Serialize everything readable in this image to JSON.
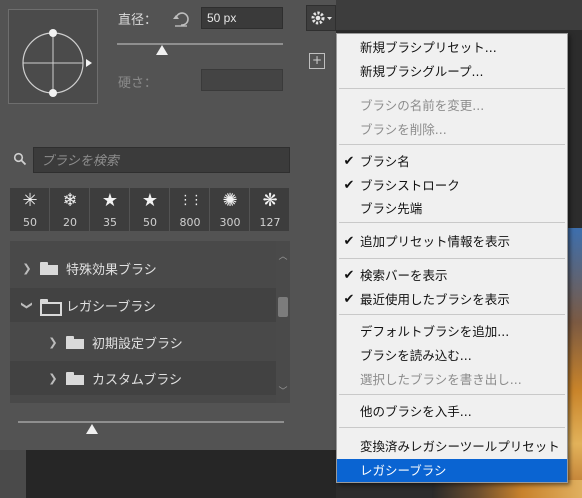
{
  "panel": {
    "diameter_label": "直径：",
    "size_value": "50 px",
    "hardness_label": "硬さ：",
    "search_placeholder": "ブラシを検索",
    "add_brush_symbol": "+",
    "brush_size_fraction": 0.27,
    "bottom_size_fraction": 0.28,
    "recent_brushes": [
      {
        "icon": "spark-brush-icon",
        "glyph": "✳",
        "size": "50"
      },
      {
        "icon": "snowflake-brush-icon",
        "glyph": "❄",
        "size": "20"
      },
      {
        "icon": "star-brush-icon",
        "glyph": "★",
        "size": "35"
      },
      {
        "icon": "star-brush-icon",
        "glyph": "★",
        "size": "50"
      },
      {
        "icon": "grass-brush-icon",
        "glyph": "⋮⋮",
        "size": "800"
      },
      {
        "icon": "splatter-brush-icon",
        "glyph": "✺",
        "size": "300"
      },
      {
        "icon": "scatter-brush-icon",
        "glyph": "❋",
        "size": "127"
      }
    ],
    "tree": [
      {
        "label": "特殊効果ブラシ",
        "chevron": "❯",
        "open": false
      },
      {
        "label": "レガシーブラシ",
        "chevron": "❯",
        "open": true
      },
      {
        "label": "初期設定ブラシ",
        "chevron": "❯",
        "open": false
      },
      {
        "label": "カスタムブラシ",
        "chevron": "❯",
        "open": false
      }
    ]
  },
  "menu": {
    "items": [
      {
        "label": "新規ブラシプリセット...",
        "disabled": false,
        "checked": false
      },
      {
        "label": "新規ブラシグループ...",
        "disabled": false,
        "checked": false
      },
      {
        "label": "ブラシの名前を変更...",
        "disabled": true,
        "checked": false
      },
      {
        "label": "ブラシを削除...",
        "disabled": true,
        "checked": false
      },
      {
        "label": "ブラシ名",
        "disabled": false,
        "checked": true
      },
      {
        "label": "ブラシストローク",
        "disabled": false,
        "checked": true
      },
      {
        "label": "ブラシ先端",
        "disabled": false,
        "checked": false
      },
      {
        "label": "追加プリセット情報を表示",
        "disabled": false,
        "checked": true
      },
      {
        "label": "検索バーを表示",
        "disabled": false,
        "checked": true
      },
      {
        "label": "最近使用したブラシを表示",
        "disabled": false,
        "checked": true
      },
      {
        "label": "デフォルトブラシを追加...",
        "disabled": false,
        "checked": false
      },
      {
        "label": "ブラシを読み込む...",
        "disabled": false,
        "checked": false
      },
      {
        "label": "選択したブラシを書き出し...",
        "disabled": true,
        "checked": false
      },
      {
        "label": "他のブラシを入手...",
        "disabled": false,
        "checked": false
      },
      {
        "label": "変換済みレガシーツールプリセット",
        "disabled": false,
        "checked": false
      },
      {
        "label": "レガシーブラシ",
        "disabled": false,
        "checked": false,
        "selected": true
      }
    ],
    "check_glyph": "✔"
  },
  "colors": {
    "panel_bg": "#535353",
    "menu_bg": "#f0f0f0",
    "selection": "#0a64d2"
  }
}
